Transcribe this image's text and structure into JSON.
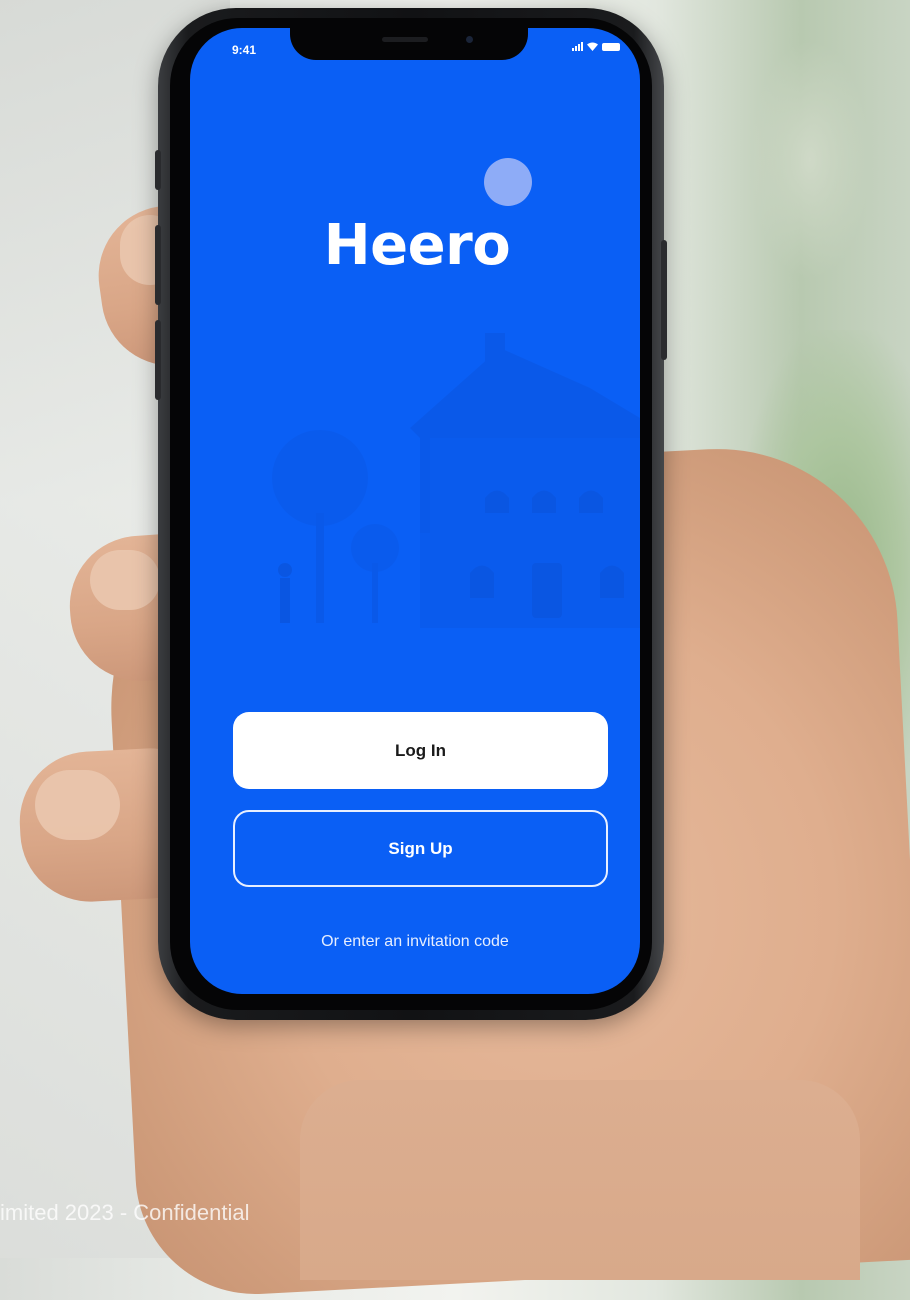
{
  "status_bar": {
    "time": "9:41"
  },
  "app": {
    "title": "Heero",
    "brand_color": "#0a5ff5",
    "logo_dot_color": "#8eacf7"
  },
  "actions": {
    "login_label": "Log In",
    "signup_label": "Sign Up",
    "invite_label": "Or enter an invitation code"
  },
  "footer": {
    "text": "imited 2023 - Confidential"
  },
  "icons": {
    "signal": "signal-icon",
    "wifi": "wifi-icon",
    "battery": "battery-icon",
    "illustration": "house-illustration"
  }
}
